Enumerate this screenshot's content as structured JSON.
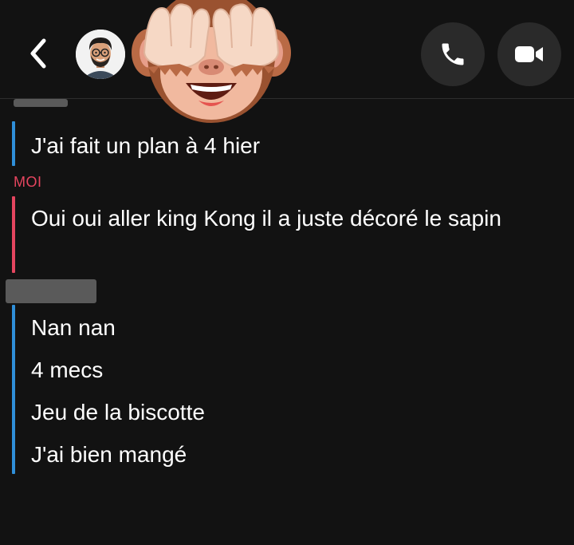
{
  "header": {
    "back_icon": "chevron-left-icon",
    "avatar_icon": "bitmoji-avatar",
    "overlay_emoji": "see-no-evil-monkey",
    "call_icon": "phone-icon",
    "video_icon": "video-camera-icon"
  },
  "colors": {
    "background": "#121212",
    "friend_bar": "#2f8fd9",
    "me_bar": "#e5455f",
    "me_label": "#e5455f"
  },
  "messages": {
    "m1": "J'ai fait un plan à 4 hier",
    "me_label": "MOI",
    "m2": "Oui oui aller king Kong il a juste décoré le sapin",
    "m3": "Nan nan",
    "m4": "4 mecs",
    "m5": "Jeu de la biscotte",
    "m6": "J'ai bien mangé"
  }
}
